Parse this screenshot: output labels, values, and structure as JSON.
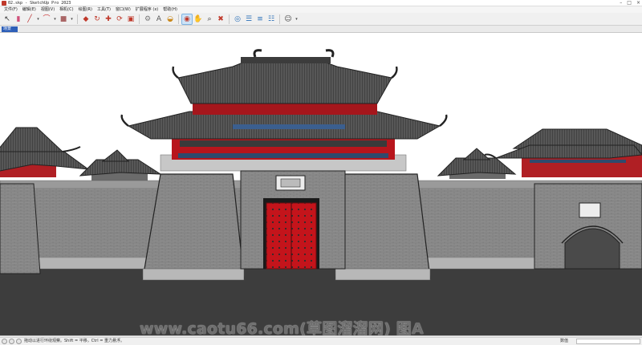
{
  "window": {
    "title": "02.skp - SketchUp Pro 2023"
  },
  "menu": [
    "文件(F)",
    "编辑(E)",
    "视图(V)",
    "相机(C)",
    "绘图(R)",
    "工具(T)",
    "窗口(W)",
    "扩展程序 (x)",
    "帮助(H)"
  ],
  "toolbar_icons": [
    "select-icon",
    "eraser-icon",
    "pencil-icon",
    "arc-icon",
    "rectangle-icon",
    "push-pull-icon",
    "follow-me-icon",
    "move-icon",
    "rotate-icon",
    "offset-icon",
    "tape-measure-icon",
    "text-icon",
    "paint-bucket-icon",
    "orbit-icon",
    "pan-icon",
    "zoom-icon",
    "zoom-extents-icon",
    "3d-warehouse-icon",
    "extension-warehouse-icon",
    "layout-icon",
    "extension-manager-icon",
    "account-icon"
  ],
  "scene_tab": {
    "label": "场景"
  },
  "viewport": {
    "watermark": "www.caotu66.com(草图溜溜网) 图A"
  },
  "status": {
    "hint": "拖动以进行环绕观察。Shift = 平移，Ctrl = 重力悬浮。",
    "measure_label": "数值",
    "measure_value": ""
  }
}
